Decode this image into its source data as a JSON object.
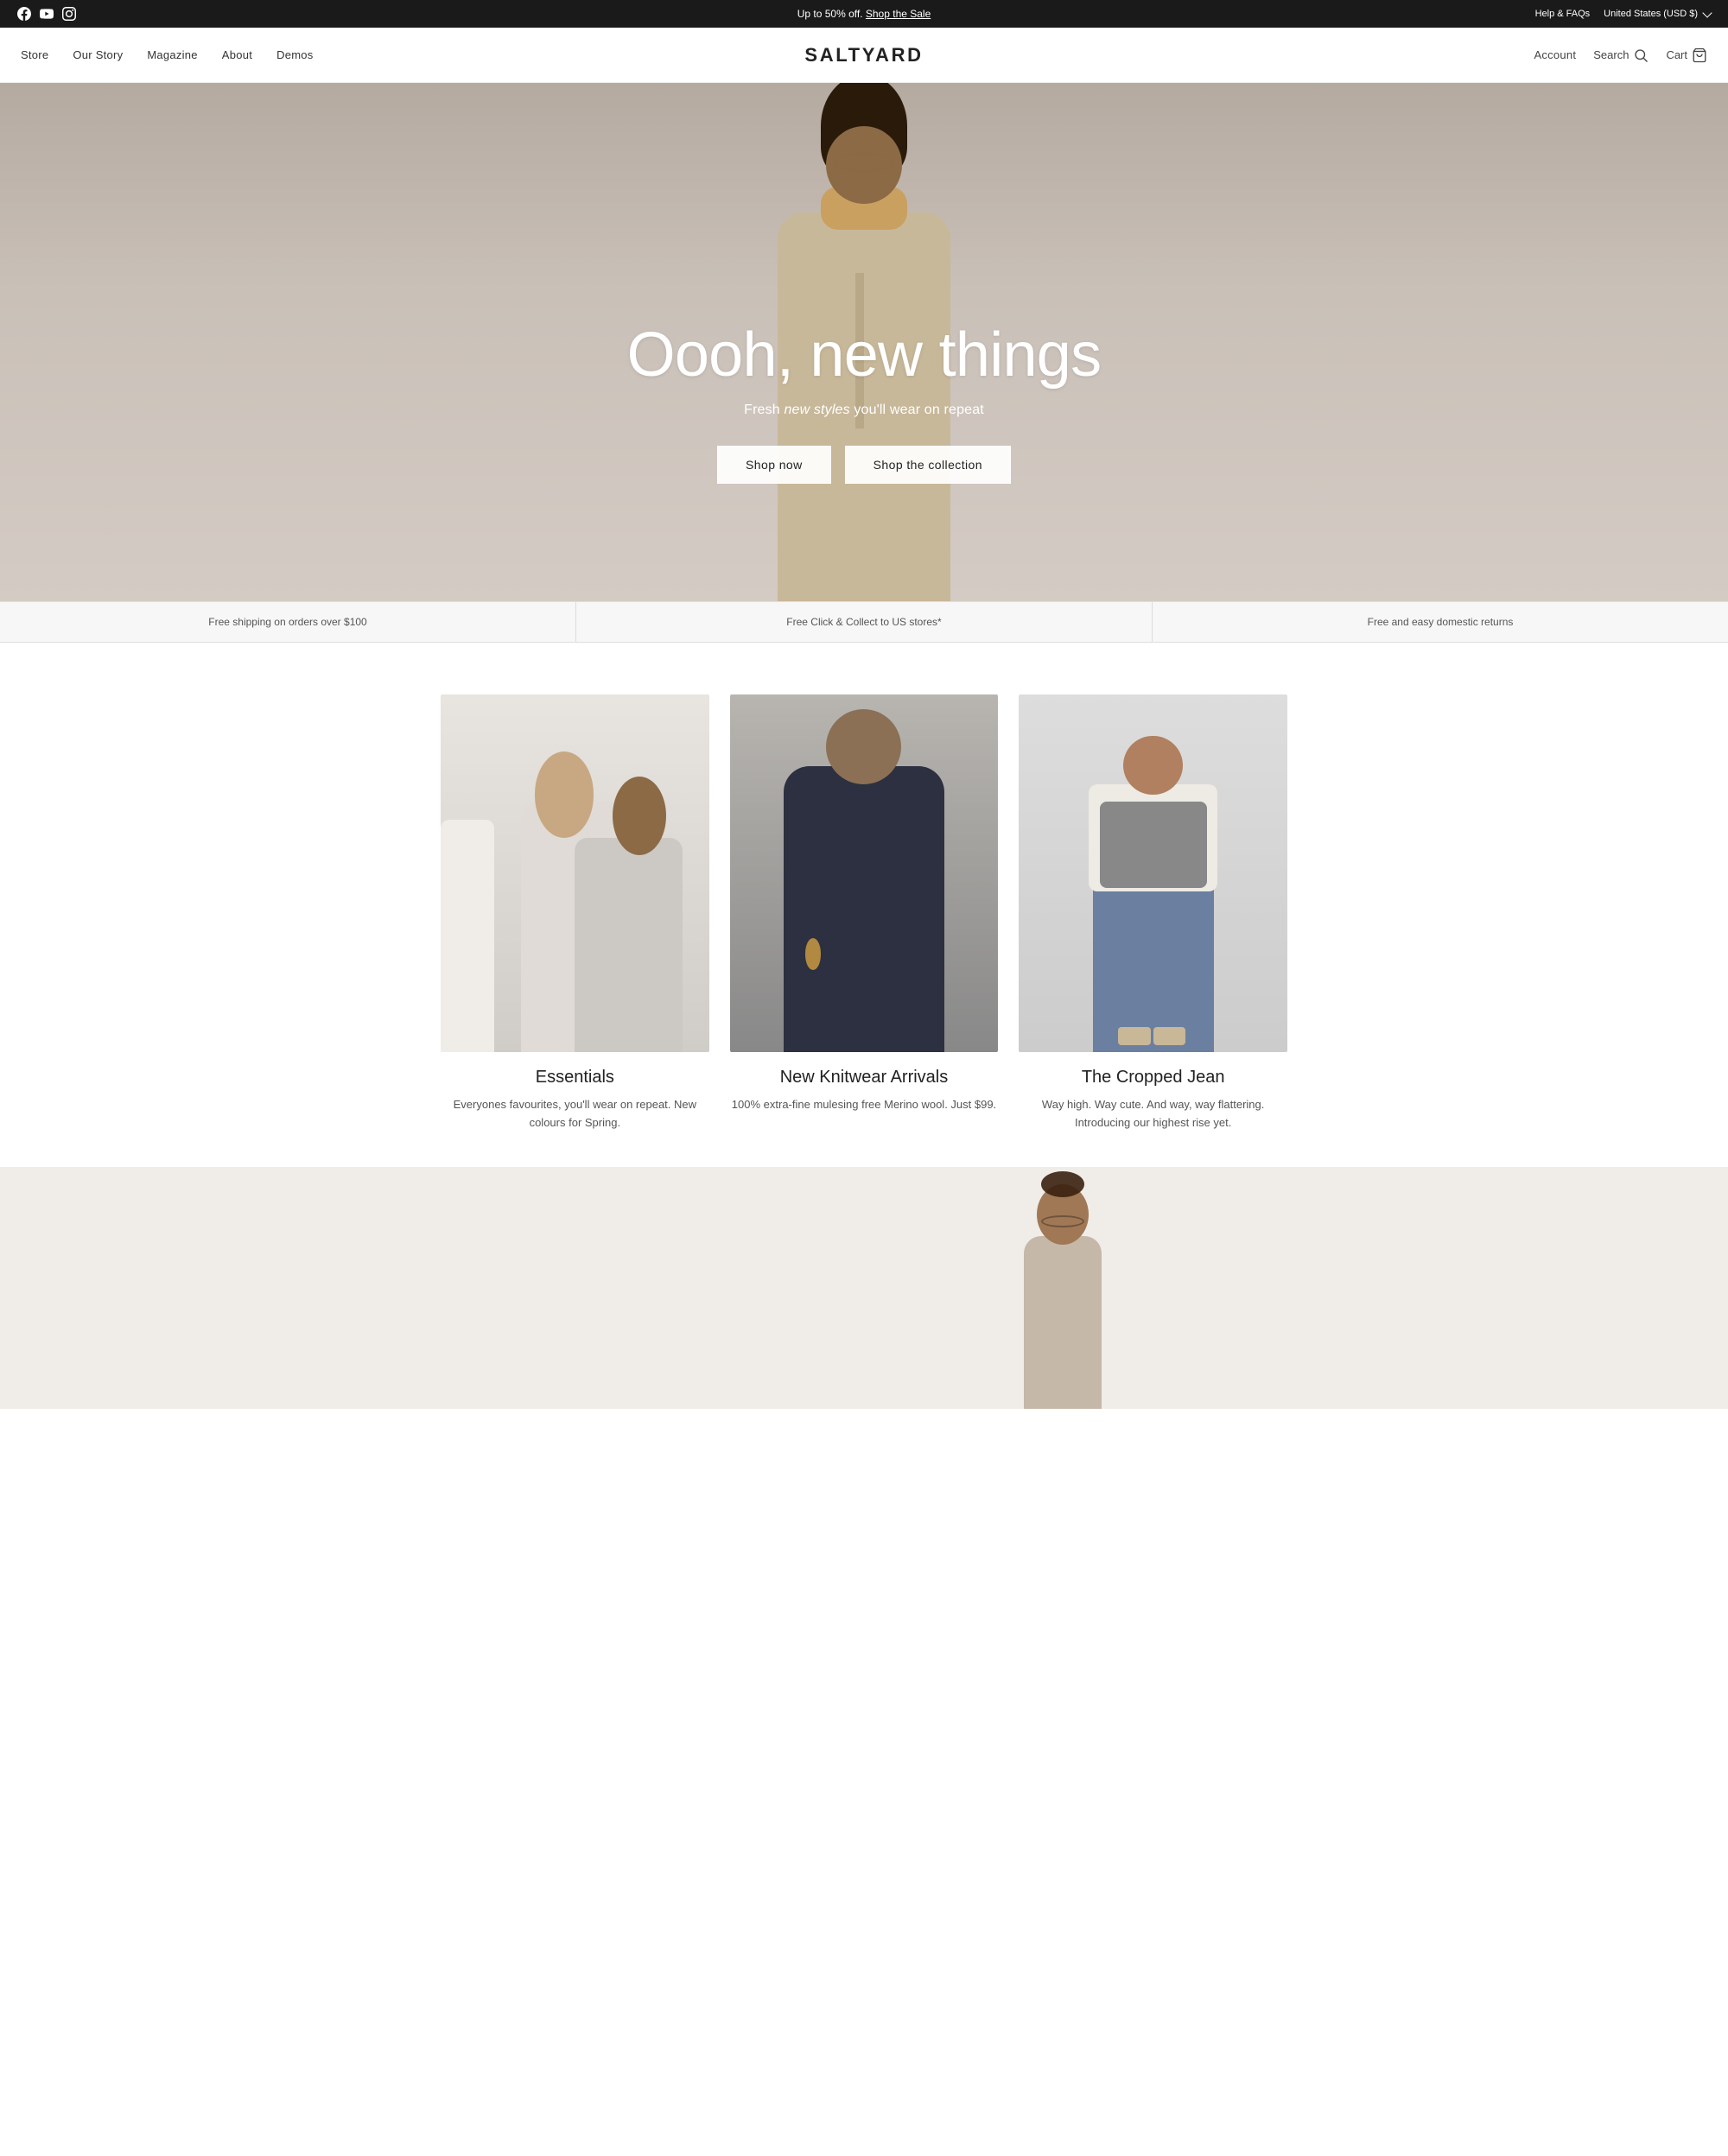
{
  "announcement": {
    "sale_text": "Up to 50% off.",
    "sale_link_label": "Shop the Sale",
    "help_label": "Help & FAQs",
    "currency_label": "United States (USD $)",
    "currency_arrow": "▾"
  },
  "social": {
    "facebook": "Facebook",
    "youtube": "YouTube",
    "instagram": "Instagram"
  },
  "nav": {
    "logo": "SALTYARD",
    "left_items": [
      {
        "label": "Store"
      },
      {
        "label": "Our Story"
      },
      {
        "label": "Magazine"
      },
      {
        "label": "About"
      },
      {
        "label": "Demos"
      }
    ],
    "account_label": "Account",
    "search_label": "Search",
    "cart_label": "Cart"
  },
  "hero": {
    "title": "Oooh, new things",
    "subtitle_plain": "Fresh ",
    "subtitle_italic": "new styles",
    "subtitle_end": " you'll wear on repeat",
    "btn_shop_now": "Shop now",
    "btn_collection": "Shop the collection"
  },
  "info_strip": [
    {
      "text": "Free shipping on orders over $100"
    },
    {
      "text": "Free Click & Collect to US stores*"
    },
    {
      "text": "Free and easy domestic returns"
    }
  ],
  "products": [
    {
      "name": "Essentials",
      "description": "Everyones favourites, you'll wear on repeat.\nNew colours for Spring."
    },
    {
      "name": "New Knitwear Arrivals",
      "description": "100% extra-fine mulesing free Merino wool.\nJust $99."
    },
    {
      "name": "The Cropped Jean",
      "description": "Way high. Way cute. And way, way flattering.\nIntroducing our highest rise yet."
    }
  ]
}
